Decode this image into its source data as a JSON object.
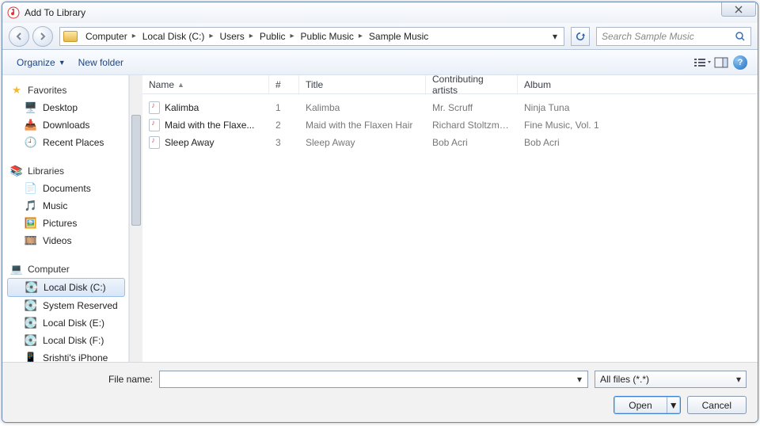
{
  "window": {
    "title": "Add To Library"
  },
  "breadcrumb": [
    "Computer",
    "Local Disk (C:)",
    "Users",
    "Public",
    "Public Music",
    "Sample Music"
  ],
  "search": {
    "placeholder": "Search Sample Music"
  },
  "toolbar": {
    "organize": "Organize",
    "newfolder": "New folder"
  },
  "sidebar": {
    "favorites": {
      "label": "Favorites",
      "items": [
        "Desktop",
        "Downloads",
        "Recent Places"
      ]
    },
    "libraries": {
      "label": "Libraries",
      "items": [
        "Documents",
        "Music",
        "Pictures",
        "Videos"
      ]
    },
    "computer": {
      "label": "Computer",
      "items": [
        "Local Disk (C:)",
        "System Reserved",
        "Local Disk (E:)",
        "Local Disk (F:)",
        "Srishti's iPhone"
      ]
    }
  },
  "columns": {
    "name": "Name",
    "num": "#",
    "title": "Title",
    "artist": "Contributing artists",
    "album": "Album"
  },
  "rows": [
    {
      "name": "Kalimba",
      "num": "1",
      "title": "Kalimba",
      "artist": "Mr. Scruff",
      "album": "Ninja Tuna"
    },
    {
      "name": "Maid with the Flaxe...",
      "num": "2",
      "title": "Maid with the Flaxen Hair",
      "artist": "Richard Stoltzman...",
      "album": "Fine Music, Vol. 1"
    },
    {
      "name": "Sleep Away",
      "num": "3",
      "title": "Sleep Away",
      "artist": "Bob Acri",
      "album": "Bob Acri"
    }
  ],
  "footer": {
    "label": "File name:",
    "filter": "All files (*.*)",
    "open": "Open",
    "cancel": "Cancel"
  }
}
